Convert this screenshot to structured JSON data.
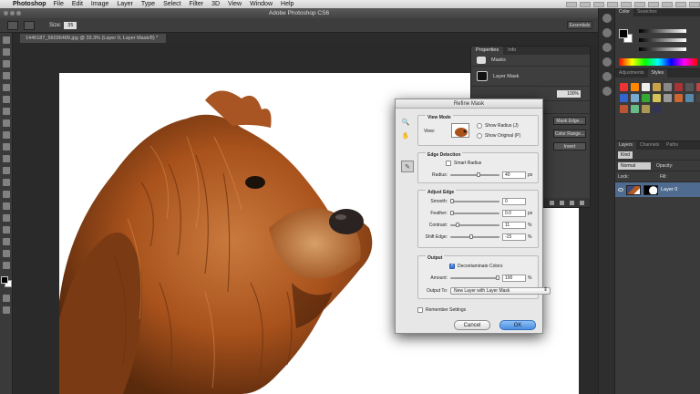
{
  "menubar": {
    "app": "Photoshop",
    "items": [
      "File",
      "Edit",
      "Image",
      "Layer",
      "Type",
      "Select",
      "Filter",
      "3D",
      "View",
      "Window",
      "Help"
    ]
  },
  "window": {
    "title": "Adobe Photoshop CS6"
  },
  "options": {
    "size_label": "Size:",
    "size_value": "35",
    "workspace": "Essentials"
  },
  "document": {
    "tab": "1446187_56036489.jpg @ 33.3% (Layer 0, Layer Mask/8) *"
  },
  "properties": {
    "tabs": [
      "Properties",
      "Info"
    ],
    "masks_label": "Masks",
    "layer_mask_label": "Layer Mask",
    "density_value": "100%",
    "buttons": [
      "Mask Edge...",
      "Color Range...",
      "Invert"
    ]
  },
  "right_dock": {
    "color_tabs": [
      "Color",
      "Swatches"
    ],
    "adj_tabs": [
      "Adjustments",
      "Styles"
    ],
    "layers_tabs": [
      "Layers",
      "Channels",
      "Paths"
    ],
    "kind_label": "Kind",
    "blend_mode": "Normal",
    "opacity_label": "Opacity:",
    "lock_label": "Lock:",
    "fill_label": "Fill:",
    "layer_name": "Layer 0"
  },
  "dialog": {
    "title": "Refine Mask",
    "view_mode": {
      "heading": "View Mode",
      "view_label": "View:",
      "show_radius": "Show Radius (J)",
      "show_original": "Show Original (P)"
    },
    "edge_detection": {
      "heading": "Edge Detection",
      "smart_radius": "Smart Radius",
      "radius_label": "Radius:",
      "radius_value": "40",
      "radius_unit": "px",
      "radius_pos": 0.58
    },
    "adjust_edge": {
      "heading": "Adjust Edge",
      "rows": [
        {
          "label": "Smooth:",
          "value": "0",
          "unit": "",
          "pos": 0.0
        },
        {
          "label": "Feather:",
          "value": "0.0",
          "unit": "px",
          "pos": 0.0
        },
        {
          "label": "Contrast:",
          "value": "11",
          "unit": "%",
          "pos": 0.11
        },
        {
          "label": "Shift Edge:",
          "value": "-15",
          "unit": "%",
          "pos": 0.42
        }
      ]
    },
    "output": {
      "heading": "Output",
      "decontaminate": "Decontaminate Colors",
      "amount_label": "Amount:",
      "amount_value": "100",
      "amount_unit": "%",
      "amount_pos": 1.0,
      "output_to_label": "Output To:",
      "output_to_value": "New Layer with Layer Mask"
    },
    "remember": "Remember Settings",
    "cancel": "Cancel",
    "ok": "OK"
  },
  "colors": {
    "ok_button": "#4a8ee0",
    "layer_selected": "#4f6b8f",
    "dog_fur": "#b55a20"
  }
}
